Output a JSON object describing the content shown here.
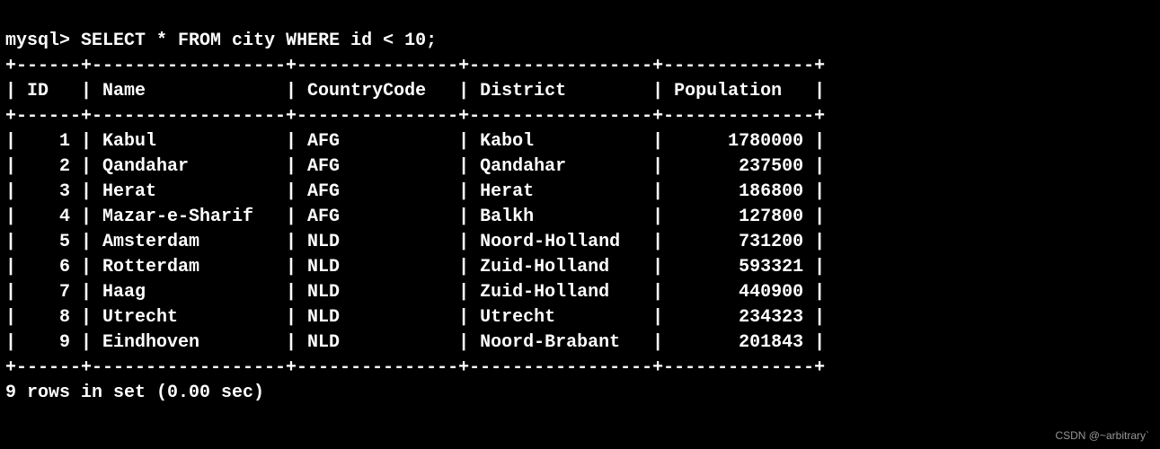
{
  "prompt": "mysql>",
  "query": "SELECT * FROM city WHERE id < 10;",
  "table": {
    "columns": [
      "ID",
      "Name",
      "CountryCode",
      "District",
      "Population"
    ],
    "widths": [
      4,
      16,
      13,
      15,
      12
    ],
    "align": [
      "right",
      "left",
      "left",
      "left",
      "right"
    ],
    "rows": [
      {
        "ID": "1",
        "Name": "Kabul",
        "CountryCode": "AFG",
        "District": "Kabol",
        "Population": "1780000"
      },
      {
        "ID": "2",
        "Name": "Qandahar",
        "CountryCode": "AFG",
        "District": "Qandahar",
        "Population": "237500"
      },
      {
        "ID": "3",
        "Name": "Herat",
        "CountryCode": "AFG",
        "District": "Herat",
        "Population": "186800"
      },
      {
        "ID": "4",
        "Name": "Mazar-e-Sharif",
        "CountryCode": "AFG",
        "District": "Balkh",
        "Population": "127800"
      },
      {
        "ID": "5",
        "Name": "Amsterdam",
        "CountryCode": "NLD",
        "District": "Noord-Holland",
        "Population": "731200"
      },
      {
        "ID": "6",
        "Name": "Rotterdam",
        "CountryCode": "NLD",
        "District": "Zuid-Holland",
        "Population": "593321"
      },
      {
        "ID": "7",
        "Name": "Haag",
        "CountryCode": "NLD",
        "District": "Zuid-Holland",
        "Population": "440900"
      },
      {
        "ID": "8",
        "Name": "Utrecht",
        "CountryCode": "NLD",
        "District": "Utrecht",
        "Population": "234323"
      },
      {
        "ID": "9",
        "Name": "Eindhoven",
        "CountryCode": "NLD",
        "District": "Noord-Brabant",
        "Population": "201843"
      }
    ]
  },
  "footer": "9 rows in set (0.00 sec)",
  "watermark": "CSDN @~arbitrary`"
}
